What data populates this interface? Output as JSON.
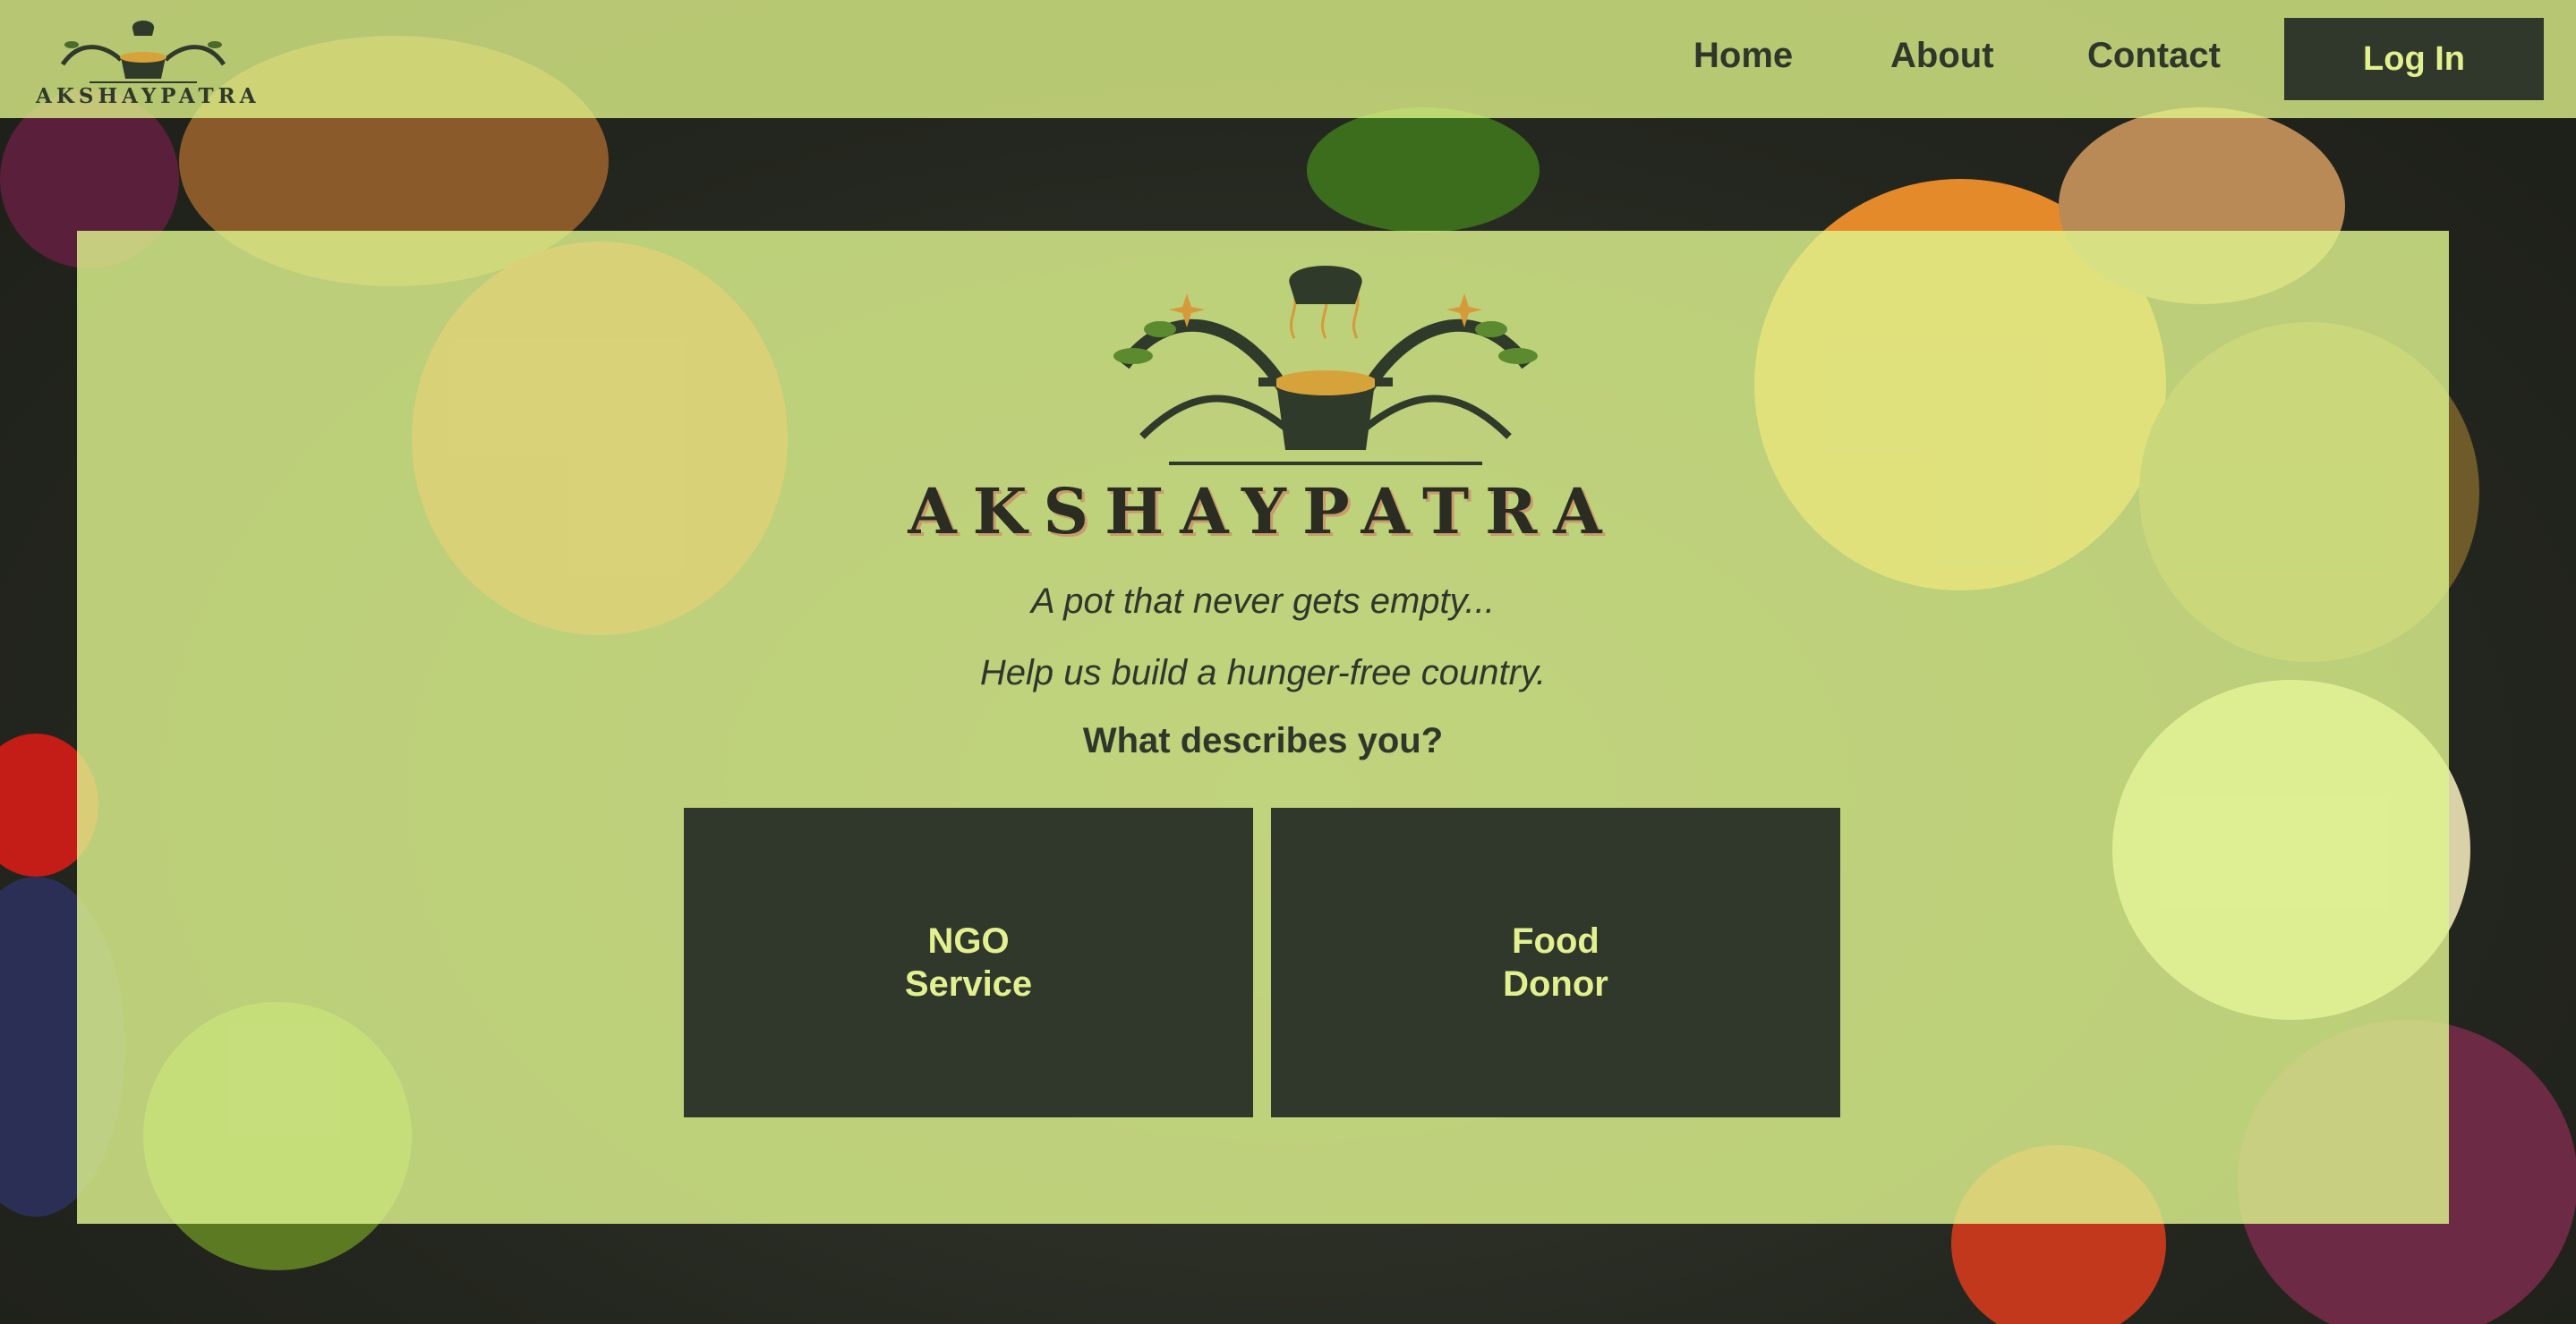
{
  "brand": {
    "name": "AKSHAYPATRA",
    "logo_icon": "cooking-pot-with-chef-hat-icon"
  },
  "nav": {
    "links": [
      "Home",
      "About",
      "Contact"
    ],
    "login_label": "Log In"
  },
  "hero": {
    "title": "AKSHAYPATRA",
    "tagline_1": "A pot that never gets empty...",
    "tagline_2": "Help us build a hunger-free country.",
    "question": "What describes you?",
    "choices": [
      "NGO\nService",
      "Food\nDonor"
    ]
  },
  "colors": {
    "overlay": "#e2f68c",
    "dark": "#30382c",
    "button_text": "#e3f08f",
    "text": "#2f372b"
  }
}
